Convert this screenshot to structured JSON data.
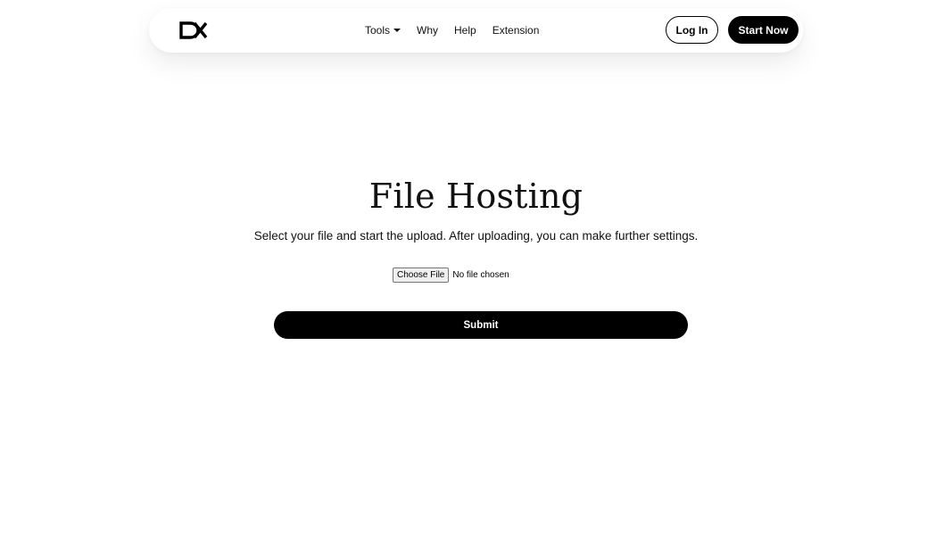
{
  "header": {
    "logo": "logo-icon",
    "nav": {
      "tools": "Tools",
      "why": "Why",
      "help": "Help",
      "extension": "Extension"
    },
    "login_label": "Log In",
    "start_label": "Start Now"
  },
  "main": {
    "title": "File Hosting",
    "subtitle": "Select your file and start the upload. After uploading, you can make further settings.",
    "file_input": {
      "button_label": "Choose File",
      "status": "No file chosen"
    },
    "submit_label": "Submit"
  },
  "colors": {
    "primary": "#000000",
    "background": "#ffffff"
  }
}
